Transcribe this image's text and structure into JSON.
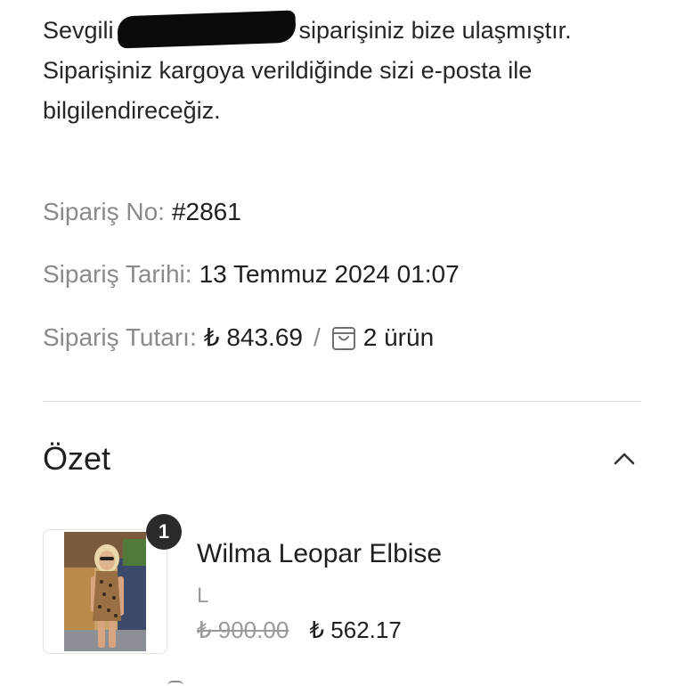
{
  "greeting": {
    "salutation": "Sevgili",
    "line_end": "siparişiniz bize ulaşmıştır.",
    "body": "Siparişiniz kargoya verildiğinde sizi e-posta ile bilgilendireceğiz."
  },
  "order": {
    "number_label": "Sipariş No:",
    "number_value": "#2861",
    "date_label": "Sipariş Tarihi:",
    "date_value": "13 Temmuz 2024 01:07",
    "total_label": "Sipariş Tutarı:",
    "total_value": "₺ 843.69",
    "separator": "/",
    "item_count": "2 ürün",
    "bag_icon": "shopping-bag-icon"
  },
  "summary": {
    "title": "Özet",
    "toggle_icon": "chevron-up-icon",
    "items": [
      {
        "quantity": "1",
        "name": "Wilma Leopar Elbise",
        "variant": "L",
        "price_old": "₺ 900.00",
        "price_new": "₺ 562.17"
      }
    ]
  },
  "colors": {
    "text_primary": "#1f1f1f",
    "text_muted": "#8a8a8a",
    "divider": "#e3e3e3",
    "badge_bg": "#2a2a2a"
  }
}
